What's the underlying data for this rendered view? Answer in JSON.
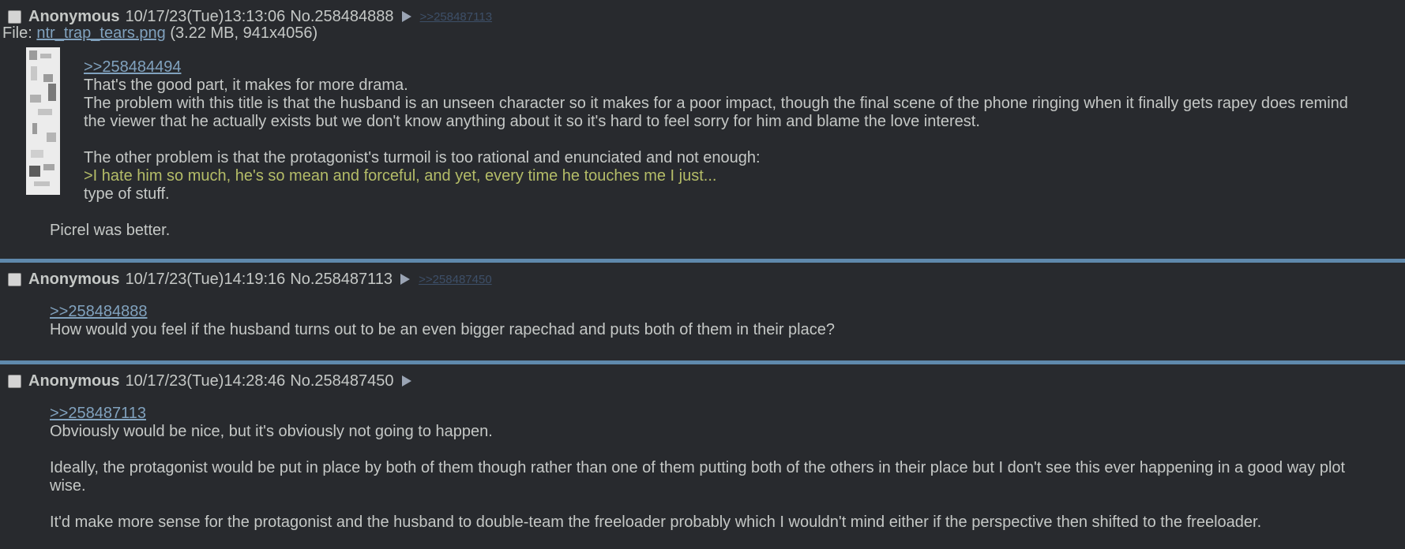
{
  "posts": [
    {
      "name": "Anonymous",
      "datetime": "10/17/23(Tue)13:13:06",
      "number": "No.258484888",
      "backlink": ">>258487113",
      "file": {
        "prefix": "File:",
        "filename": "ntr_trap_tears.png",
        "info": "(3.22 MB, 941x4056)"
      },
      "quote_link": ">>258484494",
      "lines": [
        "That's the good part, it makes for more drama.",
        "The problem with this title is that the husband is an unseen character so it makes for a poor impact, though the final scene of the phone ringing when it finally gets rapey does remind",
        "the viewer that he actually exists but we don't know anything about it so it's hard to feel sorry for him and blame the love interest.",
        "The other problem is that the protagonist's turmoil is too rational and enunciated and not enough:"
      ],
      "greentext": ">I hate him so much, he's so mean and forceful, and yet, every time he touches me I just...",
      "line_after_greentext": "type of stuff.",
      "closing_line": "Picrel was better."
    },
    {
      "name": "Anonymous",
      "datetime": "10/17/23(Tue)14:19:16",
      "number": "No.258487113",
      "backlink": ">>258487450",
      "quote_link": ">>258484888",
      "lines": [
        "How would you feel if the husband turns out to be an even bigger rapechad and puts both of them in their place?"
      ]
    },
    {
      "name": "Anonymous",
      "datetime": "10/17/23(Tue)14:28:46",
      "number": "No.258487450",
      "quote_link": ">>258487113",
      "lines": [
        "Obviously would be nice, but it's obviously not going to happen.",
        "Ideally, the protagonist would be put in place by both of them though rather than one of them putting both of the others in their place but I don't see this ever happening in a good way plot",
        "wise.",
        "It'd make more sense for the protagonist and the husband to double-team the freeloader probably which I wouldn't mind either if the perspective then shifted to the freeloader."
      ]
    }
  ],
  "colors": {
    "background": "#282a2e",
    "text": "#c5c8c6",
    "link": "#81a2be",
    "greentext": "#b5bd68",
    "divider": "#5f89ac"
  }
}
